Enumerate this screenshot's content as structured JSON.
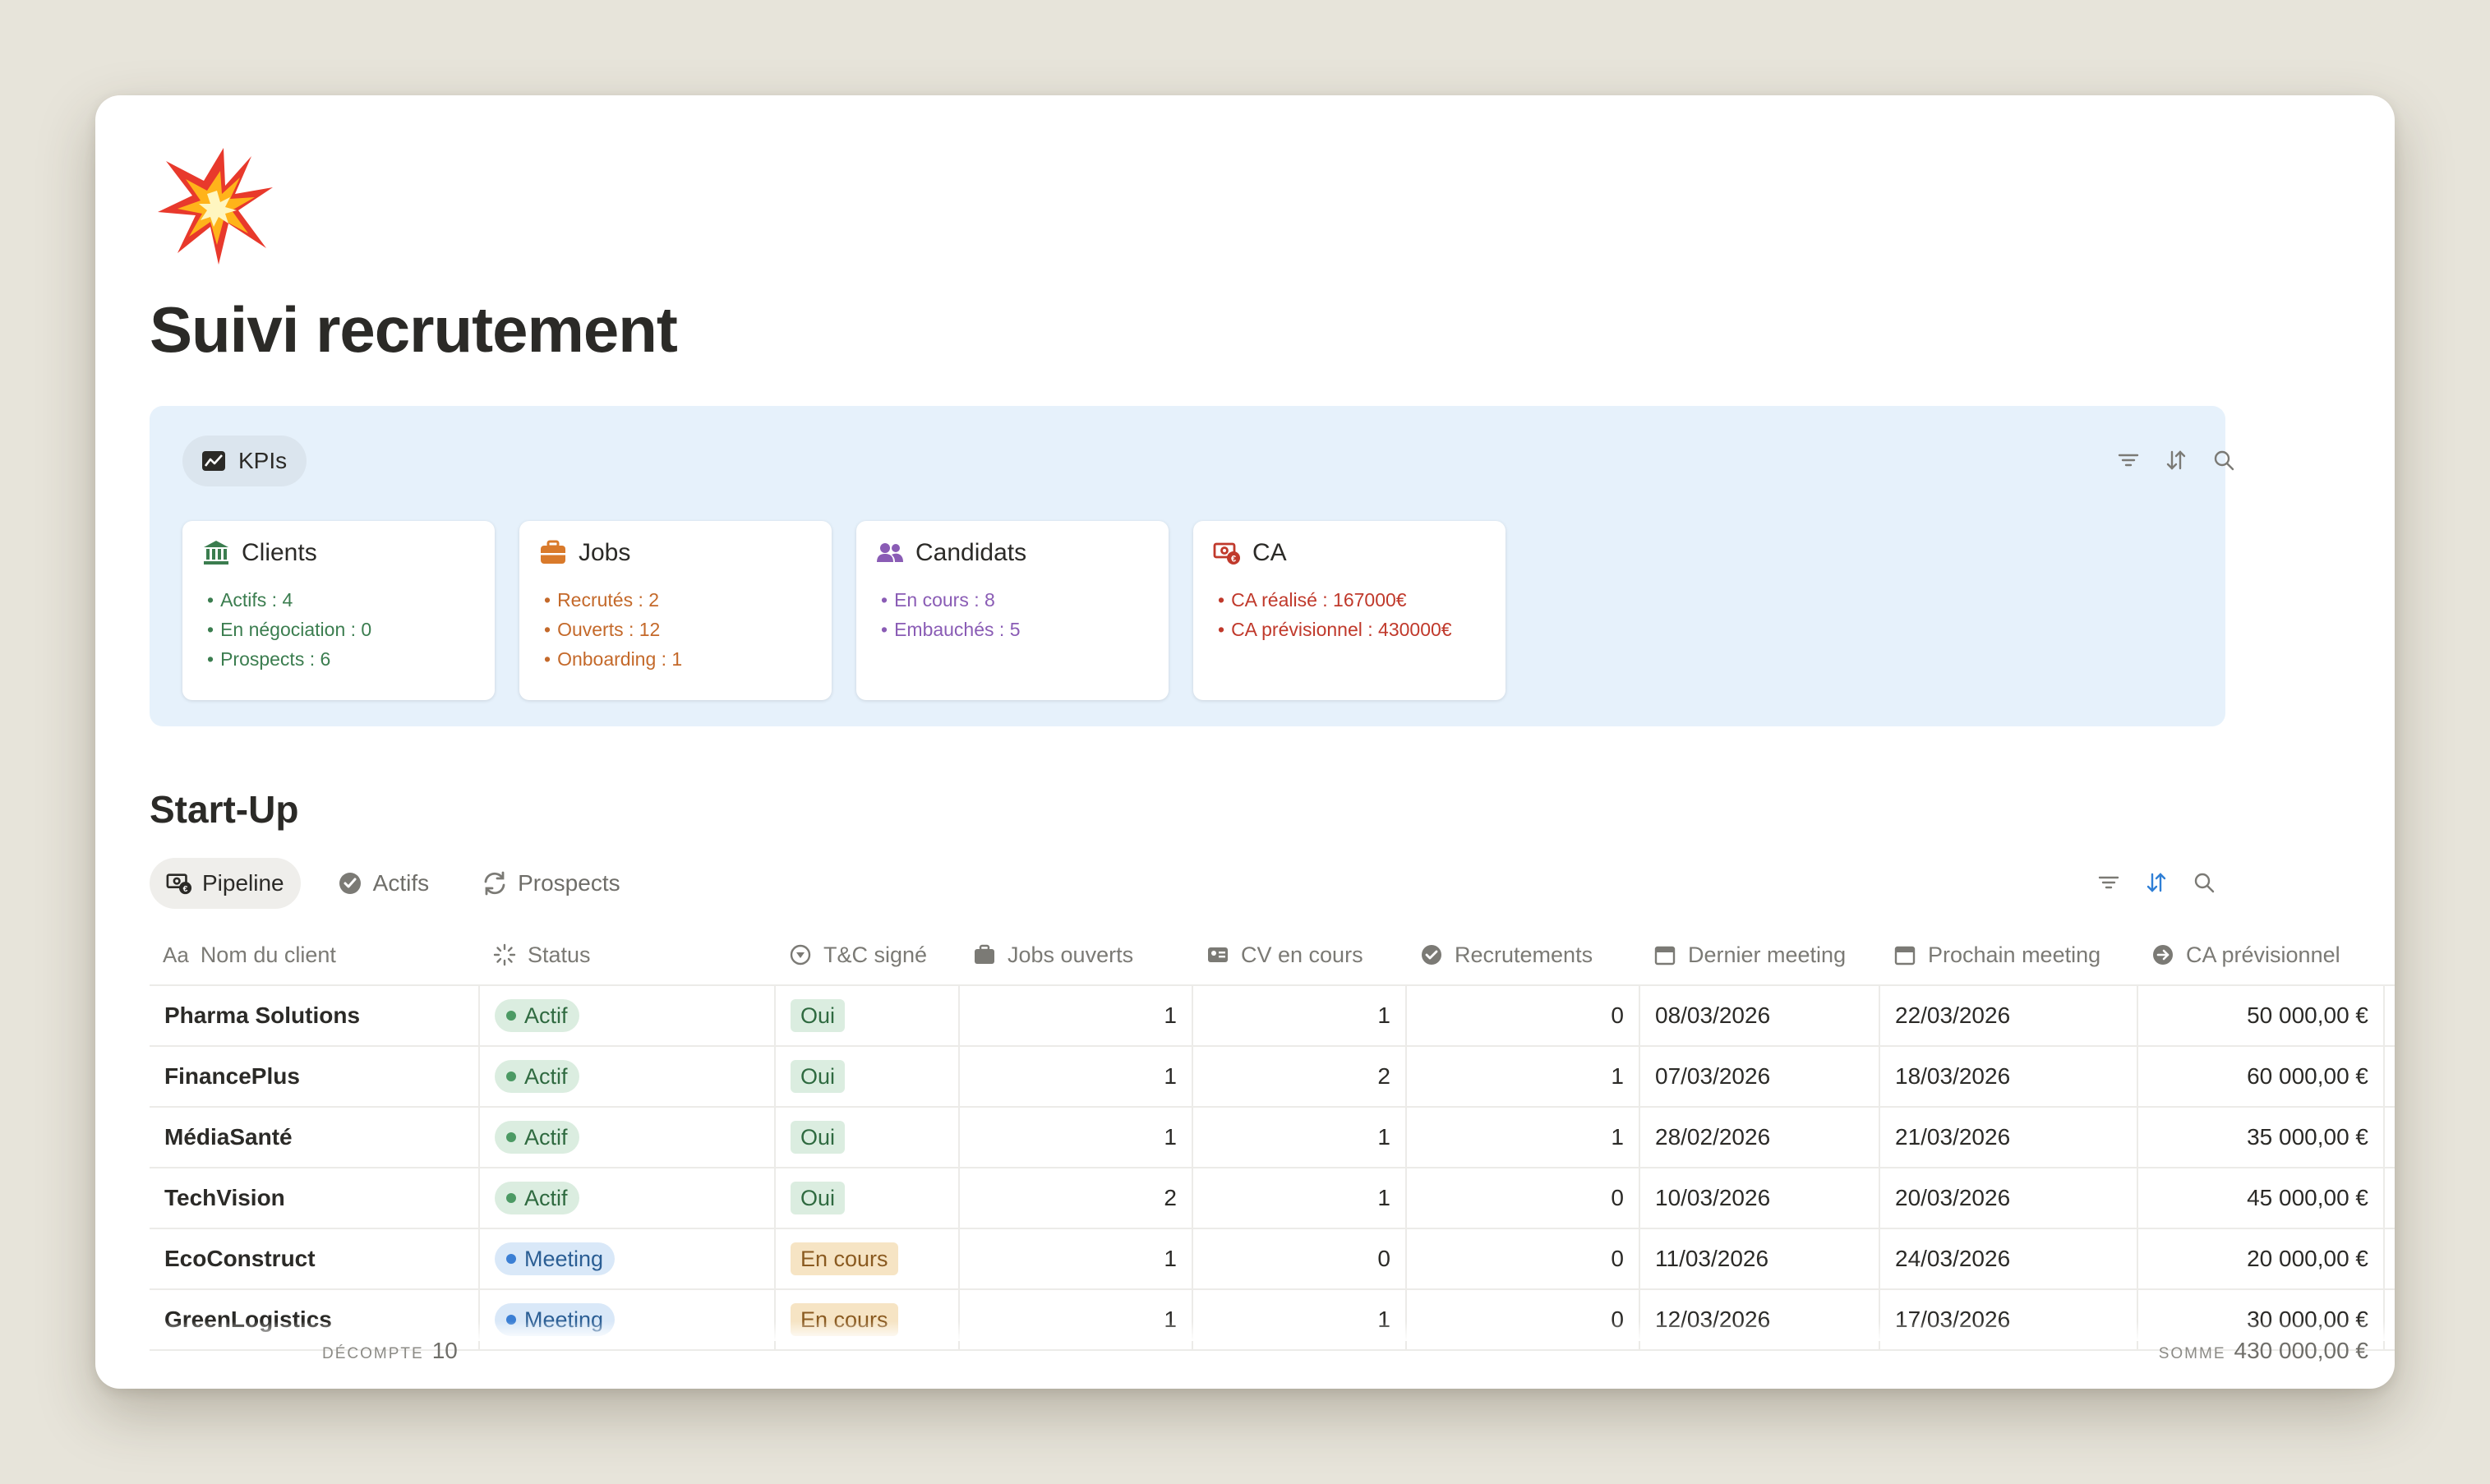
{
  "page": {
    "title": "Suivi recrutement",
    "icon": "collision-emoji-icon"
  },
  "kpis": {
    "tab_label": "KPIs",
    "cards": [
      {
        "title": "Clients",
        "icon": "bank-icon",
        "color": "#3b7d4f",
        "items": [
          "Actifs : 4",
          "En négociation : 0",
          "Prospects : 6"
        ]
      },
      {
        "title": "Jobs",
        "icon": "briefcase-icon",
        "color": "#c4692a",
        "items": [
          "Recrutés : 2",
          "Ouverts : 12",
          "Onboarding : 1"
        ]
      },
      {
        "title": "Candidats",
        "icon": "people-icon",
        "color": "#8a5cb5",
        "items": [
          "En cours : 8",
          "Embauchés : 5"
        ]
      },
      {
        "title": "CA",
        "icon": "money-icon",
        "color": "#c0392b",
        "items": [
          "CA réalisé : 167000€",
          "CA prévisionnel : 430000€"
        ]
      }
    ]
  },
  "section": {
    "title": "Start-Up",
    "tabs": [
      {
        "label": "Pipeline",
        "icon": "money-icon",
        "active": true
      },
      {
        "label": "Actifs",
        "icon": "check-circle-icon",
        "active": false
      },
      {
        "label": "Prospects",
        "icon": "refresh-icon",
        "active": false
      }
    ]
  },
  "table": {
    "columns": [
      "Nom du client",
      "Status",
      "T&C signé",
      "Jobs ouverts",
      "CV en cours",
      "Recrutements",
      "Dernier meeting",
      "Prochain meeting",
      "CA prévisionnel"
    ],
    "rows": [
      {
        "name": "Pharma Solutions",
        "status": "Actif",
        "tc": "Oui",
        "jobs": "1",
        "cv": "1",
        "recr": "0",
        "last": "08/03/2026",
        "next": "22/03/2026",
        "ca": "50 000,00 €"
      },
      {
        "name": "FinancePlus",
        "status": "Actif",
        "tc": "Oui",
        "jobs": "1",
        "cv": "2",
        "recr": "1",
        "last": "07/03/2026",
        "next": "18/03/2026",
        "ca": "60 000,00 €"
      },
      {
        "name": "MédiaSanté",
        "status": "Actif",
        "tc": "Oui",
        "jobs": "1",
        "cv": "1",
        "recr": "1",
        "last": "28/02/2026",
        "next": "21/03/2026",
        "ca": "35 000,00 €"
      },
      {
        "name": "TechVision",
        "status": "Actif",
        "tc": "Oui",
        "jobs": "2",
        "cv": "1",
        "recr": "0",
        "last": "10/03/2026",
        "next": "20/03/2026",
        "ca": "45 000,00 €"
      },
      {
        "name": "EcoConstruct",
        "status": "Meeting",
        "tc": "En cours",
        "jobs": "1",
        "cv": "0",
        "recr": "0",
        "last": "11/03/2026",
        "next": "24/03/2026",
        "ca": "20 000,00 €"
      },
      {
        "name": "GreenLogistics",
        "status": "Meeting",
        "tc": "En cours",
        "jobs": "1",
        "cv": "1",
        "recr": "0",
        "last": "12/03/2026",
        "next": "17/03/2026",
        "ca": "30 000,00 €"
      }
    ],
    "footer": {
      "count_label": "DÉCOMPTE",
      "count_value": "10",
      "sum_label": "SOMME",
      "sum_value": "430 000,00 €"
    }
  }
}
